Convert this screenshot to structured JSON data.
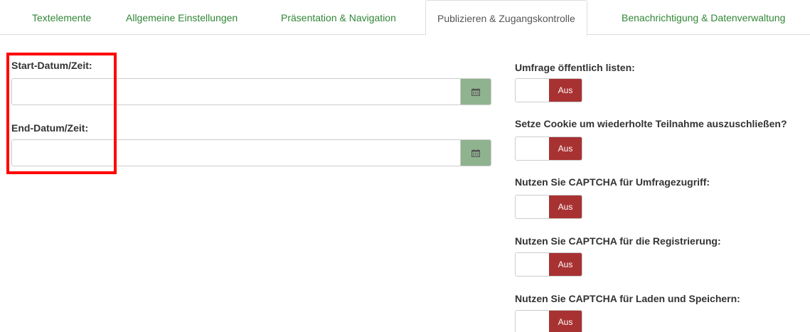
{
  "tabs": [
    {
      "label": "Textelemente",
      "active": false
    },
    {
      "label": "Allgemeine Einstellungen",
      "active": false
    },
    {
      "label": "Präsentation & Navigation",
      "active": false
    },
    {
      "label": "Publizieren & Zugangskontrolle",
      "active": true
    },
    {
      "label": "Benachrichtigung & Datenverwaltung",
      "active": false
    }
  ],
  "left": {
    "start_label": "Start-Datum/Zeit:",
    "start_value": "",
    "end_label": "End-Datum/Zeit:",
    "end_value": "",
    "calendar_icon": "calendar-icon"
  },
  "right": {
    "options": [
      {
        "label": "Umfrage öffentlich listen:",
        "state": "Aus"
      },
      {
        "label": "Setze Cookie um wiederholte Teilnahme auszuschließen?",
        "state": "Aus"
      },
      {
        "label": "Nutzen Sie CAPTCHA für Umfragezugriff:",
        "state": "Aus"
      },
      {
        "label": "Nutzen Sie CAPTCHA für die Registrierung:",
        "state": "Aus"
      },
      {
        "label": "Nutzen Sie CAPTCHA für Laden und Speichern:",
        "state": "Aus"
      }
    ]
  },
  "colors": {
    "tab_link": "#328637",
    "addon_green": "#8fb38f",
    "toggle_off": "#a83232",
    "highlight": "#ff0000"
  }
}
